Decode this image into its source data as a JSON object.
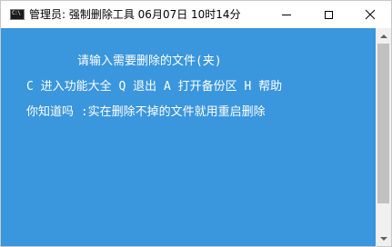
{
  "window": {
    "title": "管理员:  强制删除工具  06月07日 10时14分",
    "icon": "console-icon",
    "icon_text": "C:\\"
  },
  "console": {
    "background": "#3a96dd",
    "foreground": "#ffffff",
    "lines": [
      "请输入需要删除的文件(夹)",
      "C 进入功能大全 Q 退出 A 打开备份区 H 帮助",
      "你知道吗 :实在删除不掉的文件就用重启删除"
    ]
  },
  "controls": {
    "minimize": "minimize-icon",
    "maximize": "maximize-icon",
    "close": "close-icon"
  }
}
